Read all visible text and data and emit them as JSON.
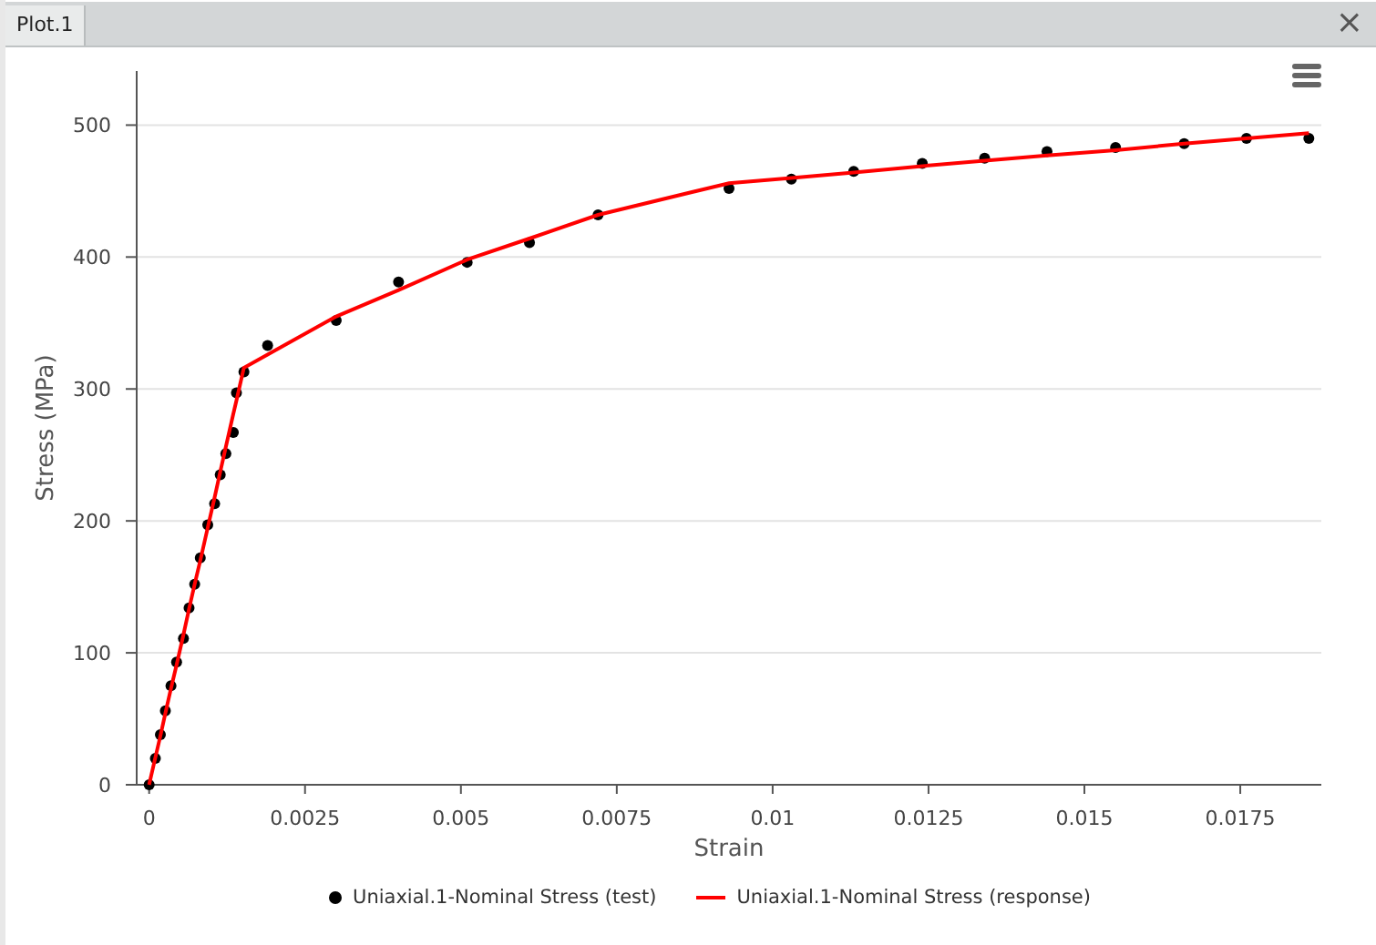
{
  "tab": {
    "label": "Plot.1",
    "selected": true
  },
  "close_label": "×",
  "plot": {
    "chart_data": {
      "type": "line",
      "grid": true,
      "xlabel": "Strain",
      "ylabel": "Stress (MPa)",
      "x": [
        0,
        0.0001,
        0.00018,
        0.00026,
        0.00035,
        0.00044,
        0.00055,
        0.00064,
        0.00073,
        0.00082,
        0.00094,
        0.00105,
        0.00114,
        0.00123,
        0.00135,
        0.0014,
        0.00152,
        0.0019,
        0.003,
        0.004,
        0.0051,
        0.0061,
        0.0072,
        0.0093,
        0.0103,
        0.0113,
        0.0124,
        0.0134,
        0.0144,
        0.0155,
        0.0166,
        0.0176,
        0.0186
      ],
      "series": [
        {
          "name": "Uniaxial.1-Nominal Stress (test)",
          "color": "#000000",
          "type": "scatter",
          "marker": "circle",
          "values": [
            0,
            20,
            38,
            56,
            75,
            93,
            111,
            134,
            152,
            172,
            197,
            213,
            235,
            251,
            267,
            297,
            313,
            333,
            352,
            381,
            396,
            411,
            432,
            452,
            459,
            465,
            471,
            475,
            480,
            483,
            486,
            490,
            490
          ]
        },
        {
          "name": "Uniaxial.1-Nominal Stress (response)",
          "color": "#ff0000",
          "type": "line",
          "values": [
            0,
            21,
            37,
            54,
            73,
            91,
            114,
            133,
            152,
            170,
            195,
            218,
            237,
            256,
            281,
            291,
            316,
            326,
            355,
            375,
            398,
            414,
            432,
            456,
            460,
            464,
            469,
            473,
            477,
            481,
            486,
            490,
            494
          ]
        }
      ],
      "xlim": [
        -0.0002,
        0.0188
      ],
      "ylim": [
        0,
        541
      ],
      "xticks": [
        {
          "value": 0,
          "label": "0"
        },
        {
          "value": 0.0025,
          "label": "0.0025"
        },
        {
          "value": 0.005,
          "label": "0.005"
        },
        {
          "value": 0.0075,
          "label": "0.0075"
        },
        {
          "value": 0.01,
          "label": "0.01"
        },
        {
          "value": 0.0125,
          "label": "0.0125"
        },
        {
          "value": 0.015,
          "label": "0.015"
        },
        {
          "value": 0.0175,
          "label": "0.0175"
        }
      ],
      "yticks": [
        0,
        100,
        200,
        300,
        400,
        500
      ]
    }
  }
}
